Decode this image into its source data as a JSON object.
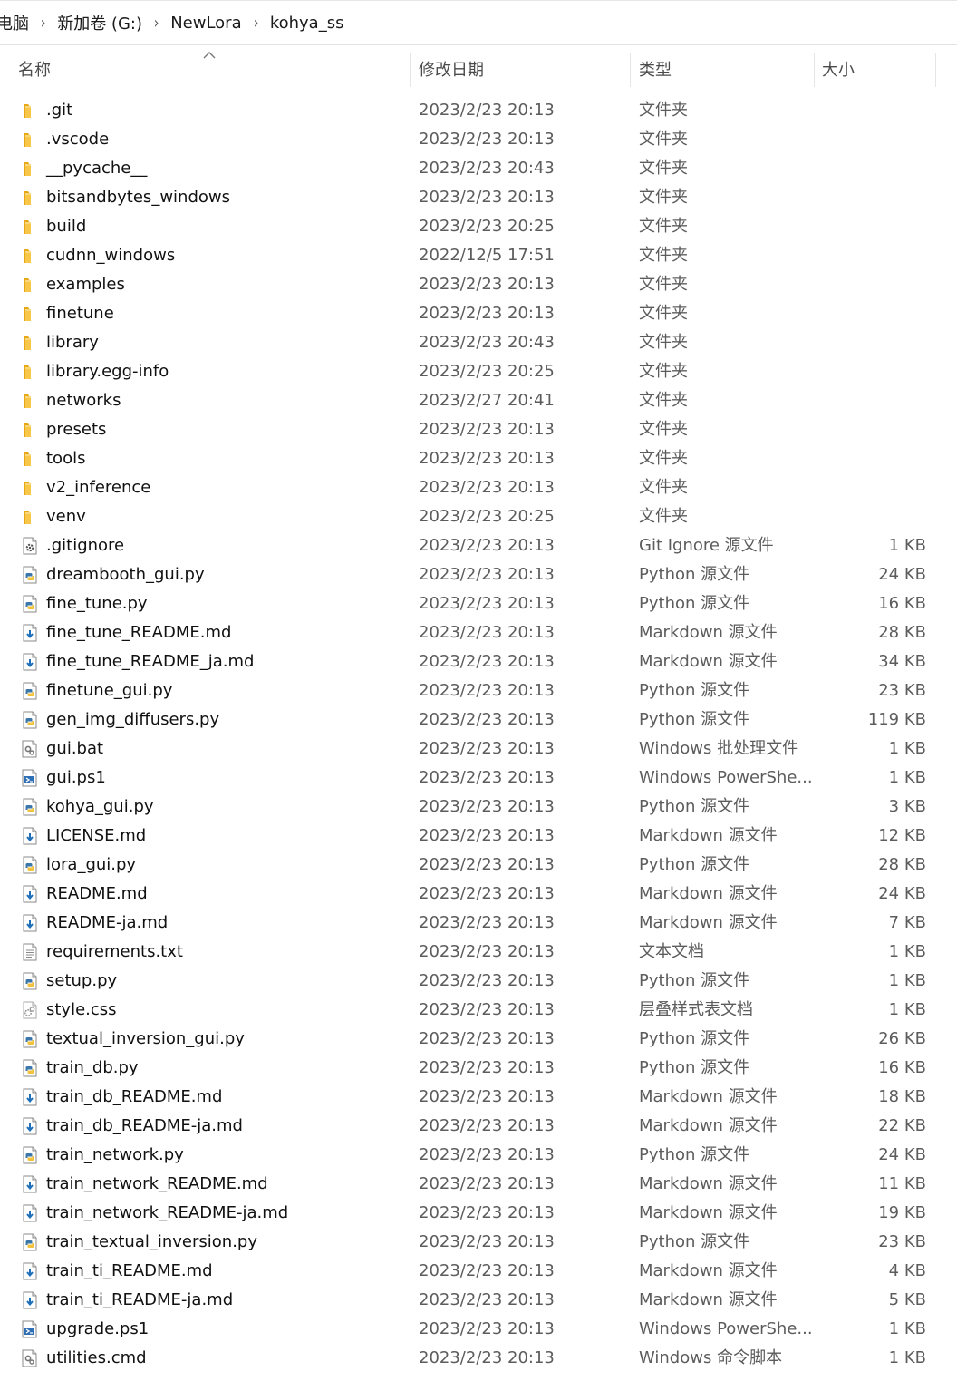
{
  "breadcrumb": {
    "items": [
      "电脑",
      "新加卷 (G:)",
      "NewLora",
      "kohya_ss"
    ],
    "separator": "›"
  },
  "columns": {
    "name": "名称",
    "date": "修改日期",
    "type": "类型",
    "size": "大小"
  },
  "colors": {
    "folder": "#F8C74A",
    "folder_dark": "#E6A817",
    "python_blue": "#3B77A8",
    "markdown_blue": "#1E6FB8",
    "header_text": "#4B4B4B",
    "meta_text": "#5C5C5C"
  },
  "files": [
    {
      "name": ".git",
      "date": "2023/2/23 20:13",
      "type": "文件夹",
      "size": "",
      "icon": "folder-icon"
    },
    {
      "name": ".vscode",
      "date": "2023/2/23 20:13",
      "type": "文件夹",
      "size": "",
      "icon": "folder-icon"
    },
    {
      "name": "__pycache__",
      "date": "2023/2/23 20:43",
      "type": "文件夹",
      "size": "",
      "icon": "folder-icon"
    },
    {
      "name": "bitsandbytes_windows",
      "date": "2023/2/23 20:13",
      "type": "文件夹",
      "size": "",
      "icon": "folder-icon"
    },
    {
      "name": "build",
      "date": "2023/2/23 20:25",
      "type": "文件夹",
      "size": "",
      "icon": "folder-icon"
    },
    {
      "name": "cudnn_windows",
      "date": "2022/12/5 17:51",
      "type": "文件夹",
      "size": "",
      "icon": "folder-icon"
    },
    {
      "name": "examples",
      "date": "2023/2/23 20:13",
      "type": "文件夹",
      "size": "",
      "icon": "folder-icon"
    },
    {
      "name": "finetune",
      "date": "2023/2/23 20:13",
      "type": "文件夹",
      "size": "",
      "icon": "folder-icon"
    },
    {
      "name": "library",
      "date": "2023/2/23 20:43",
      "type": "文件夹",
      "size": "",
      "icon": "folder-icon"
    },
    {
      "name": "library.egg-info",
      "date": "2023/2/23 20:25",
      "type": "文件夹",
      "size": "",
      "icon": "folder-icon"
    },
    {
      "name": "networks",
      "date": "2023/2/27 20:41",
      "type": "文件夹",
      "size": "",
      "icon": "folder-icon"
    },
    {
      "name": "presets",
      "date": "2023/2/23 20:13",
      "type": "文件夹",
      "size": "",
      "icon": "folder-icon"
    },
    {
      "name": "tools",
      "date": "2023/2/23 20:13",
      "type": "文件夹",
      "size": "",
      "icon": "folder-icon"
    },
    {
      "name": "v2_inference",
      "date": "2023/2/23 20:13",
      "type": "文件夹",
      "size": "",
      "icon": "folder-icon"
    },
    {
      "name": "venv",
      "date": "2023/2/23 20:25",
      "type": "文件夹",
      "size": "",
      "icon": "folder-icon"
    },
    {
      "name": ".gitignore",
      "date": "2023/2/23 20:13",
      "type": "Git Ignore 源文件",
      "size": "1 KB",
      "icon": "settings-file-icon"
    },
    {
      "name": "dreambooth_gui.py",
      "date": "2023/2/23 20:13",
      "type": "Python 源文件",
      "size": "24 KB",
      "icon": "python-file-icon"
    },
    {
      "name": "fine_tune.py",
      "date": "2023/2/23 20:13",
      "type": "Python 源文件",
      "size": "16 KB",
      "icon": "python-file-icon"
    },
    {
      "name": "fine_tune_README.md",
      "date": "2023/2/23 20:13",
      "type": "Markdown 源文件",
      "size": "28 KB",
      "icon": "markdown-file-icon"
    },
    {
      "name": "fine_tune_README_ja.md",
      "date": "2023/2/23 20:13",
      "type": "Markdown 源文件",
      "size": "34 KB",
      "icon": "markdown-file-icon"
    },
    {
      "name": "finetune_gui.py",
      "date": "2023/2/23 20:13",
      "type": "Python 源文件",
      "size": "23 KB",
      "icon": "python-file-icon"
    },
    {
      "name": "gen_img_diffusers.py",
      "date": "2023/2/23 20:13",
      "type": "Python 源文件",
      "size": "119 KB",
      "icon": "python-file-icon"
    },
    {
      "name": "gui.bat",
      "date": "2023/2/23 20:13",
      "type": "Windows 批处理文件",
      "size": "1 KB",
      "icon": "batch-file-icon"
    },
    {
      "name": "gui.ps1",
      "date": "2023/2/23 20:13",
      "type": "Windows PowerShe...",
      "size": "1 KB",
      "icon": "powershell-file-icon"
    },
    {
      "name": "kohya_gui.py",
      "date": "2023/2/23 20:13",
      "type": "Python 源文件",
      "size": "3 KB",
      "icon": "python-file-icon"
    },
    {
      "name": "LICENSE.md",
      "date": "2023/2/23 20:13",
      "type": "Markdown 源文件",
      "size": "12 KB",
      "icon": "markdown-file-icon"
    },
    {
      "name": "lora_gui.py",
      "date": "2023/2/23 20:13",
      "type": "Python 源文件",
      "size": "28 KB",
      "icon": "python-file-icon"
    },
    {
      "name": "README.md",
      "date": "2023/2/23 20:13",
      "type": "Markdown 源文件",
      "size": "24 KB",
      "icon": "markdown-file-icon"
    },
    {
      "name": "README-ja.md",
      "date": "2023/2/23 20:13",
      "type": "Markdown 源文件",
      "size": "7 KB",
      "icon": "markdown-file-icon"
    },
    {
      "name": "requirements.txt",
      "date": "2023/2/23 20:13",
      "type": "文本文档",
      "size": "1 KB",
      "icon": "text-file-icon"
    },
    {
      "name": "setup.py",
      "date": "2023/2/23 20:13",
      "type": "Python 源文件",
      "size": "1 KB",
      "icon": "python-file-icon"
    },
    {
      "name": "style.css",
      "date": "2023/2/23 20:13",
      "type": "层叠样式表文档",
      "size": "1 KB",
      "icon": "css-file-icon"
    },
    {
      "name": "textual_inversion_gui.py",
      "date": "2023/2/23 20:13",
      "type": "Python 源文件",
      "size": "26 KB",
      "icon": "python-file-icon"
    },
    {
      "name": "train_db.py",
      "date": "2023/2/23 20:13",
      "type": "Python 源文件",
      "size": "16 KB",
      "icon": "python-file-icon"
    },
    {
      "name": "train_db_README.md",
      "date": "2023/2/23 20:13",
      "type": "Markdown 源文件",
      "size": "18 KB",
      "icon": "markdown-file-icon"
    },
    {
      "name": "train_db_README-ja.md",
      "date": "2023/2/23 20:13",
      "type": "Markdown 源文件",
      "size": "22 KB",
      "icon": "markdown-file-icon"
    },
    {
      "name": "train_network.py",
      "date": "2023/2/23 20:13",
      "type": "Python 源文件",
      "size": "24 KB",
      "icon": "python-file-icon"
    },
    {
      "name": "train_network_README.md",
      "date": "2023/2/23 20:13",
      "type": "Markdown 源文件",
      "size": "11 KB",
      "icon": "markdown-file-icon"
    },
    {
      "name": "train_network_README-ja.md",
      "date": "2023/2/23 20:13",
      "type": "Markdown 源文件",
      "size": "19 KB",
      "icon": "markdown-file-icon"
    },
    {
      "name": "train_textual_inversion.py",
      "date": "2023/2/23 20:13",
      "type": "Python 源文件",
      "size": "23 KB",
      "icon": "python-file-icon"
    },
    {
      "name": "train_ti_README.md",
      "date": "2023/2/23 20:13",
      "type": "Markdown 源文件",
      "size": "4 KB",
      "icon": "markdown-file-icon"
    },
    {
      "name": "train_ti_README-ja.md",
      "date": "2023/2/23 20:13",
      "type": "Markdown 源文件",
      "size": "5 KB",
      "icon": "markdown-file-icon"
    },
    {
      "name": "upgrade.ps1",
      "date": "2023/2/23 20:13",
      "type": "Windows PowerShe...",
      "size": "1 KB",
      "icon": "powershell-file-icon"
    },
    {
      "name": "utilities.cmd",
      "date": "2023/2/23 20:13",
      "type": "Windows 命令脚本",
      "size": "1 KB",
      "icon": "batch-file-icon"
    }
  ]
}
